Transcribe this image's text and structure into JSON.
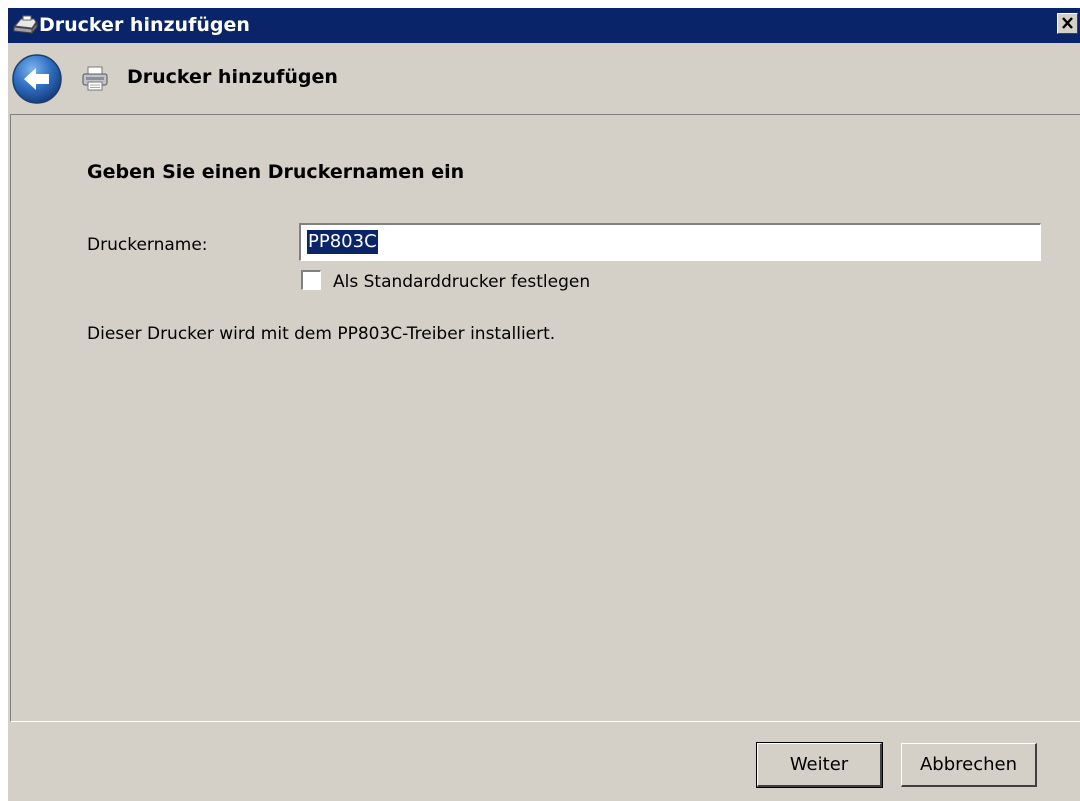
{
  "window": {
    "title": "Drucker hinzufügen",
    "close_label": "✕"
  },
  "header": {
    "title": "Drucker hinzufügen",
    "back_icon": "back-arrow-icon",
    "printer_icon": "printer-icon"
  },
  "main": {
    "heading": "Geben Sie einen Druckernamen ein",
    "name_label": "Druckername:",
    "name_value": "PP803C",
    "default_checkbox": {
      "label": "Als Standarddrucker festlegen",
      "checked": false
    },
    "driver_info": "Dieser Drucker wird mit dem PP803C-Treiber installiert."
  },
  "footer": {
    "next_label": "Weiter",
    "cancel_label": "Abbrechen"
  },
  "colors": {
    "title_bar": "#0a246a",
    "window_bg": "#d4d0c8",
    "selection": "#0a246a"
  }
}
